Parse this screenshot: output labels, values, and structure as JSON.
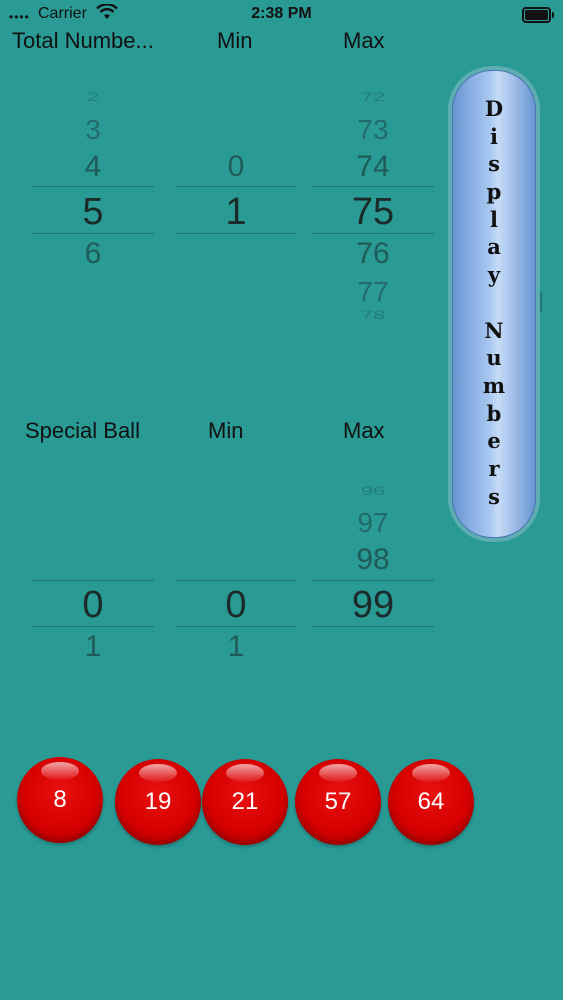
{
  "status_bar": {
    "carrier": "Carrier",
    "time": "2:38 PM"
  },
  "main_pickers": {
    "headers": [
      "Total Numbe...",
      "Min",
      "Max"
    ],
    "total": {
      "above": [
        "2",
        "3",
        "4"
      ],
      "selected": "5",
      "below": [
        "6"
      ]
    },
    "min": {
      "above": [
        "0"
      ],
      "selected": "1",
      "below": []
    },
    "max": {
      "above": [
        "72",
        "73",
        "74"
      ],
      "selected": "75",
      "below": [
        "76",
        "77",
        "78"
      ]
    }
  },
  "special_pickers": {
    "headers": [
      "Special Ball",
      "Min",
      "Max"
    ],
    "special": {
      "above": [],
      "selected": "0",
      "below": [
        "1"
      ]
    },
    "min": {
      "above": [],
      "selected": "0",
      "below": [
        "1"
      ]
    },
    "max": {
      "above": [
        "96",
        "97",
        "98"
      ],
      "selected": "99",
      "below": []
    }
  },
  "display_button": {
    "label": "Display Numbers",
    "letters": [
      "D",
      "i",
      "s",
      "p",
      "l",
      "a",
      "y",
      "",
      "N",
      "u",
      "m",
      "b",
      "e",
      "r",
      "s"
    ]
  },
  "balls": [
    "8",
    "19",
    "21",
    "57",
    "64"
  ],
  "colors": {
    "background": "#2a9a95",
    "ball": "#d60000",
    "button": "#a9c8f1"
  }
}
